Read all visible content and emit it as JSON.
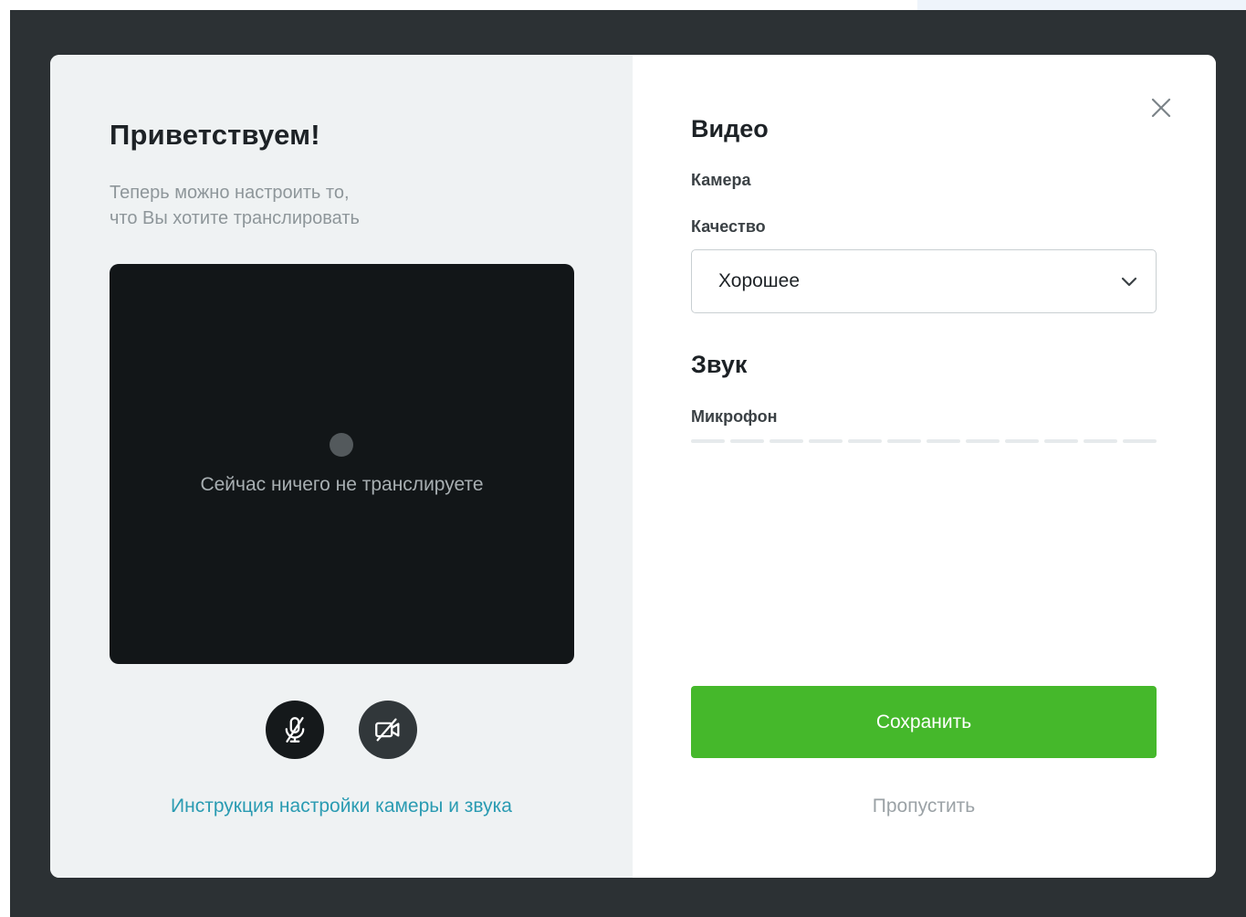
{
  "welcome": {
    "title": "Приветствуем!",
    "subtitle_line1": "Теперь можно настроить то,",
    "subtitle_line2": "что Вы хотите транслировать"
  },
  "preview": {
    "status_text": "Сейчас ничего не транслируете"
  },
  "controls": {
    "mic_icon": "mic-off-icon",
    "camera_icon": "camera-off-icon"
  },
  "help_link": "Инструкция настройки камеры и звука",
  "video": {
    "heading": "Видео",
    "camera_label": "Камера",
    "quality_label": "Качество",
    "quality_value": "Хорошее"
  },
  "sound": {
    "heading": "Звук",
    "mic_label": "Микрофон",
    "mic_level": 0
  },
  "actions": {
    "save_label": "Сохранить",
    "skip_label": "Пропустить"
  },
  "colors": {
    "accent_green": "#45b82b",
    "link_blue": "#2a9bb2",
    "backdrop": "#2c3134"
  }
}
